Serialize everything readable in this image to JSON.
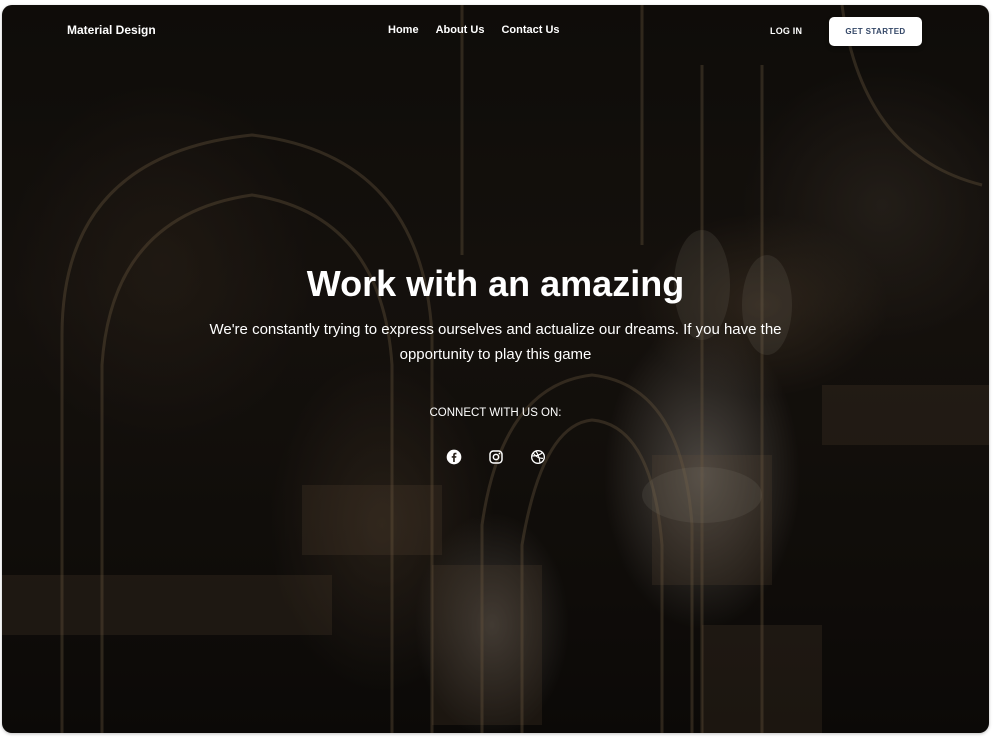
{
  "navbar": {
    "brand": "Material Design",
    "links": [
      "Home",
      "About Us",
      "Contact Us"
    ],
    "login_label": "LOG IN",
    "cta_label": "GET STARTED"
  },
  "hero": {
    "title": "Work with an amazing",
    "subtitle": "We're constantly trying to express ourselves and actualize our dreams. If you have the opportunity to play this game",
    "connect_label": "CONNECT WITH US ON:",
    "social_icons": [
      "facebook-icon",
      "instagram-icon",
      "dribbble-icon"
    ]
  },
  "colors": {
    "text": "#ffffff",
    "button_bg": "#ffffff",
    "button_text": "#344767",
    "overlay": "rgba(0,0,0,0.35)"
  }
}
